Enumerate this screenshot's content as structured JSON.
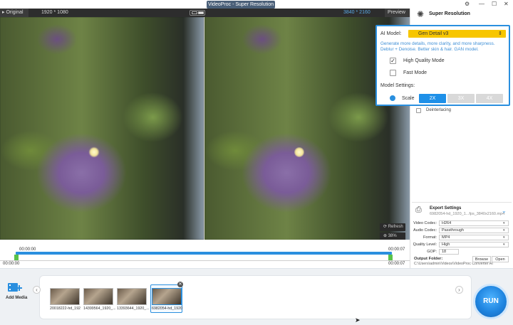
{
  "window": {
    "title": "VideoProc - Super Resolution",
    "settings_icon": "gear-icon",
    "min": "—",
    "max": "☐",
    "close": "✕"
  },
  "preview": {
    "original_tab": "Original",
    "original_icon": "play-icon",
    "original_res": "1920 * 1080",
    "output_res": "3840 * 2160",
    "preview_tab": "Preview",
    "refresh_label": "Refresh",
    "zoom_label": "38%"
  },
  "timeline": {
    "start_top": "00:00:00",
    "start_bottom": "00:00:00",
    "end_top": "00:00:07",
    "end_bottom": "00:00:07"
  },
  "panel": {
    "title": "Super Resolution",
    "ai_model_label": "AI Model:",
    "ai_model_value": "Gen Detail v3",
    "ai_description": "Generate more details, more clarity, and more sharpness. Deblur + Denoise. Better skin & hair. GAN model.",
    "high_quality_label": "High Quality Mode",
    "high_quality_checked": "✓",
    "fast_mode_label": "Fast Mode",
    "model_settings_label": "Model Settings:",
    "scale_label": "Scale",
    "scale_options": [
      "2X",
      "3X",
      "4X"
    ],
    "deinterlacing_label": "Deinterlacing",
    "accent_color": "#2a8fdf",
    "select_color": "#f7c600"
  },
  "export": {
    "title": "Export Settings",
    "filename": "6982054-hd_1920_1...fps_3840x2160.mp4",
    "fields": [
      {
        "label": "Video Codec:",
        "value": "H264"
      },
      {
        "label": "Audio Codec:",
        "value": "Passthrough"
      },
      {
        "label": "Format:",
        "value": "MP4"
      },
      {
        "label": "Quality Level:",
        "value": "High"
      }
    ],
    "gop_label": "GOP:",
    "gop_value": "18",
    "output_folder_label": "Output Folder:",
    "output_path": "C:\\Users\\admin\\Videos\\VideoProc Converter AI",
    "browse": "Browse",
    "open": "Open"
  },
  "media": {
    "add_label": "Add Media",
    "items": [
      {
        "label": "20018222-hd_192"
      },
      {
        "label": "14399564_1920_..."
      },
      {
        "label": "13393644_1920_..."
      },
      {
        "label": "6982054-hd_1920"
      }
    ],
    "run": "RUN"
  }
}
